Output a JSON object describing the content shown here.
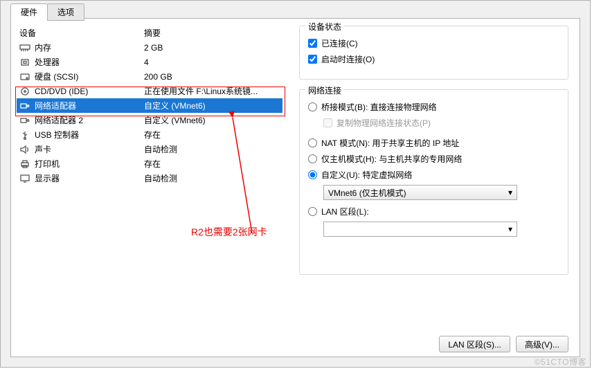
{
  "tabs": {
    "hardware": "硬件",
    "options": "选项"
  },
  "headers": {
    "device": "设备",
    "summary": "摘要"
  },
  "devices": [
    {
      "icon": "memory",
      "name": "内存",
      "summary": "2 GB"
    },
    {
      "icon": "cpu",
      "name": "处理器",
      "summary": "4"
    },
    {
      "icon": "disk",
      "name": "硬盘 (SCSI)",
      "summary": "200 GB"
    },
    {
      "icon": "cd",
      "name": "CD/DVD (IDE)",
      "summary": "正在使用文件 F:\\Linux系统镜..."
    },
    {
      "icon": "net",
      "name": "网络适配器",
      "summary": "自定义 (VMnet6)"
    },
    {
      "icon": "net",
      "name": "网络适配器 2",
      "summary": "自定义 (VMnet6)"
    },
    {
      "icon": "usb",
      "name": "USB 控制器",
      "summary": "存在"
    },
    {
      "icon": "sound",
      "name": "声卡",
      "summary": "自动检测"
    },
    {
      "icon": "printer",
      "name": "打印机",
      "summary": "存在"
    },
    {
      "icon": "display",
      "name": "显示器",
      "summary": "自动检测"
    }
  ],
  "annotation": "R2也需要2张网卡",
  "status": {
    "legend": "设备状态",
    "connected": "已连接(C)",
    "connect_at_poweron": "启动时连接(O)"
  },
  "net": {
    "legend": "网络连接",
    "bridged": "桥接模式(B): 直接连接物理网络",
    "replicate": "复制物理网络连接状态(P)",
    "nat": "NAT 模式(N): 用于共享主机的 IP 地址",
    "hostonly": "仅主机模式(H): 与主机共享的专用网络",
    "custom": "自定义(U): 特定虚拟网络",
    "custom_value": "VMnet6 (仅主机模式)",
    "lan": "LAN 区段(L):",
    "lan_value": ""
  },
  "buttons": {
    "lan_segments": "LAN 区段(S)...",
    "advanced": "高级(V)..."
  },
  "watermark": "©51CTO博客"
}
